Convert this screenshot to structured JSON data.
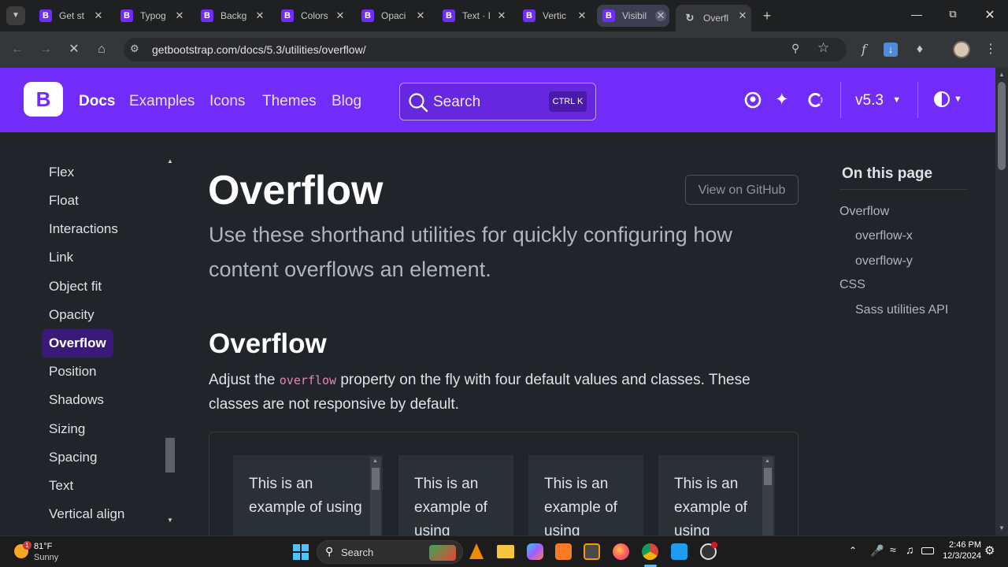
{
  "browser": {
    "tabs": [
      {
        "title": "Get st",
        "icon": "bootstrap-icon"
      },
      {
        "title": "Typog",
        "icon": "bootstrap-icon"
      },
      {
        "title": "Backg",
        "icon": "bootstrap-icon"
      },
      {
        "title": "Colors",
        "icon": "bootstrap-icon"
      },
      {
        "title": "Opaci",
        "icon": "bootstrap-icon"
      },
      {
        "title": "Text · I",
        "icon": "bootstrap-icon"
      },
      {
        "title": "Vertic",
        "icon": "bootstrap-icon"
      },
      {
        "title": "Visibil",
        "icon": "bootstrap-icon"
      },
      {
        "title": "Overfl",
        "icon": "loading-icon"
      }
    ],
    "url": "getbootstrap.com/docs/5.3/utilities/overflow/"
  },
  "navbar": {
    "brand": "B",
    "links": [
      "Docs",
      "Examples",
      "Icons",
      "Themes",
      "Blog"
    ],
    "search_label": "Search",
    "search_shortcut": "CTRL K",
    "version": "v5.3"
  },
  "sidebar": {
    "items": [
      "Flex",
      "Float",
      "Interactions",
      "Link",
      "Object fit",
      "Opacity",
      "Overflow",
      "Position",
      "Shadows",
      "Sizing",
      "Spacing",
      "Text",
      "Vertical align"
    ],
    "active": "Overflow"
  },
  "main": {
    "title": "Overflow",
    "github_button": "View on GitHub",
    "lead_line1": "Use these shorthand utilities for quickly configuring how",
    "lead_line2": "content overflows an element.",
    "h2": "Overflow",
    "para_before": "Adjust the",
    "para_code": "overflow",
    "para_after": "property on the fly with four default values and classes. These",
    "para_line2": "classes are not responsive by default.",
    "demos": [
      "This is an example of using",
      "This is an example of using",
      "This is an example of using",
      "This is an example of using"
    ]
  },
  "toc": {
    "heading": "On this page",
    "items": [
      "Overflow",
      "overflow-x",
      "overflow-y",
      "CSS",
      "Sass utilities API"
    ]
  },
  "taskbar": {
    "weather_temp": "81°F",
    "weather_desc": "Sunny",
    "search_label": "Search",
    "time": "2:46 PM",
    "date": "12/3/2024",
    "weather_badge": "1"
  },
  "colors": {
    "brand": "#712cf9",
    "bg": "#212529",
    "code": "#e685b5"
  }
}
